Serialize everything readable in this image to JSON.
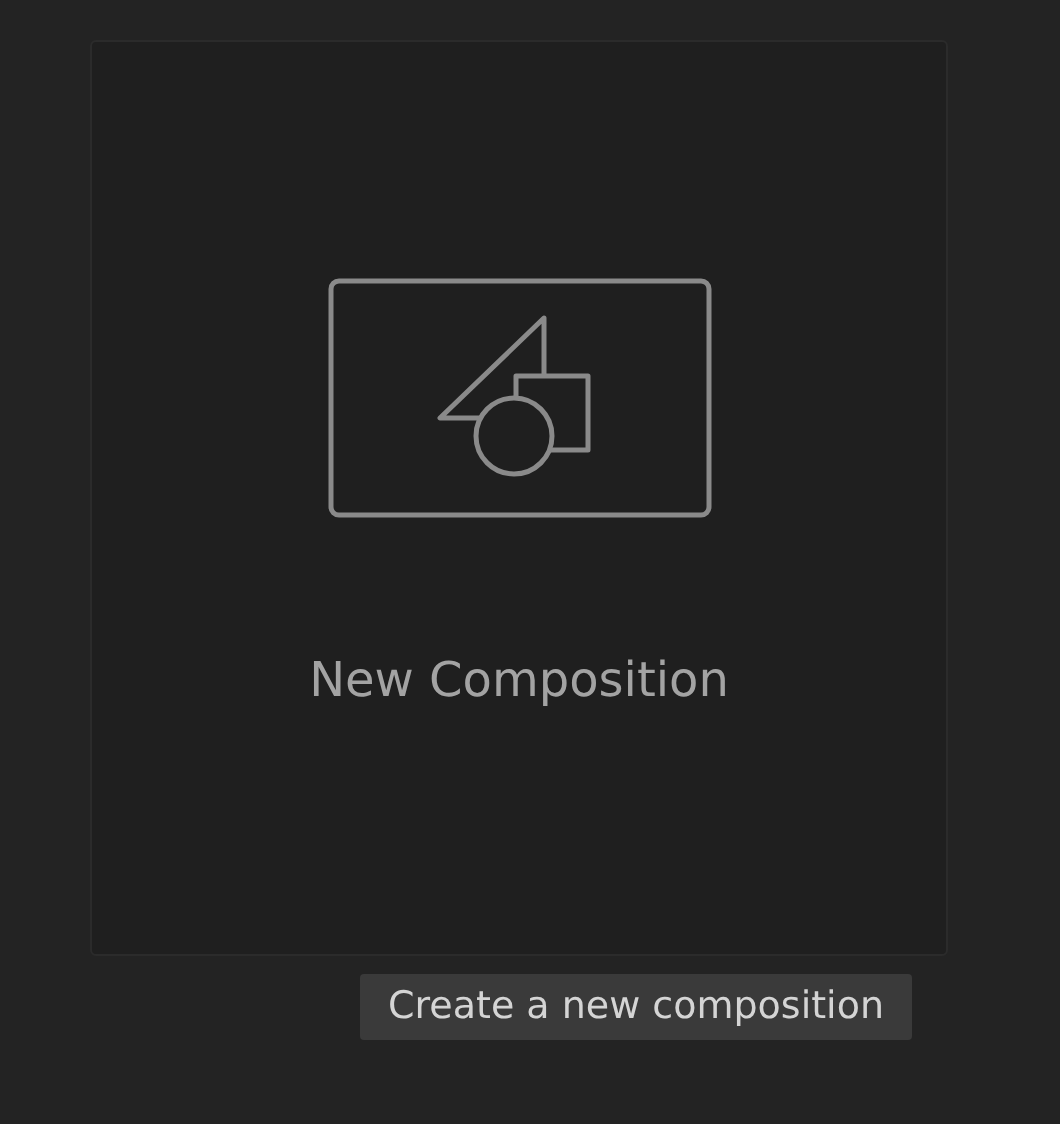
{
  "card": {
    "label": "New Composition"
  },
  "tooltip": {
    "text": "Create a new composition"
  }
}
